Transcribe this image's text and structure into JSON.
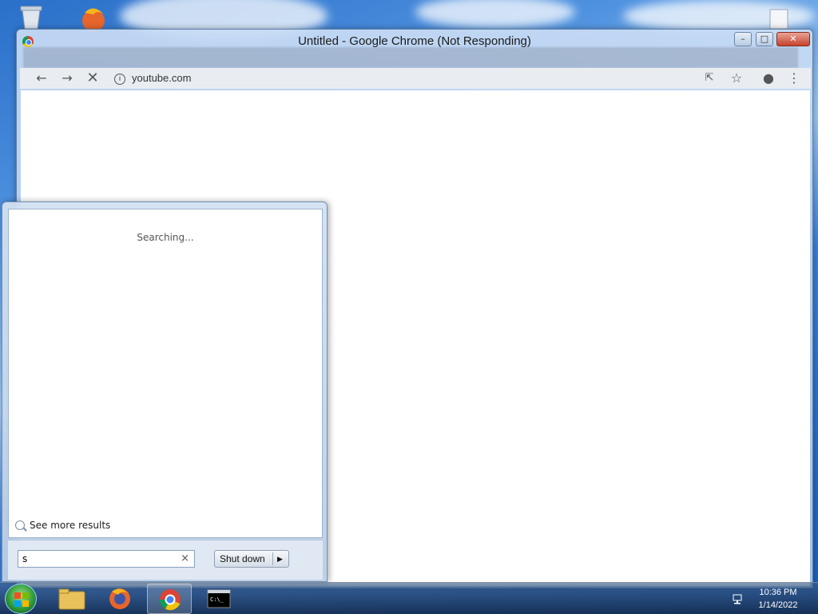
{
  "chrome_window": {
    "title": "Untitled - Google Chrome (Not Responding)",
    "url": "youtube.com"
  },
  "start_menu": {
    "status": "Searching...",
    "see_more": "See more results",
    "search_value": "s",
    "clear_glyph": "×",
    "shutdown_label": "Shut down",
    "shutdown_arrow": "▶"
  },
  "taskbar": {
    "apps": [
      "windows-explorer",
      "firefox",
      "google-chrome",
      "command-prompt"
    ],
    "active_app": "google-chrome",
    "time": "10:36 PM",
    "date": "1/14/2022"
  },
  "colors": {
    "desktop_blue": "#2a6fc9",
    "close_red": "#c7402c",
    "taskbar": "#1d3a66"
  }
}
